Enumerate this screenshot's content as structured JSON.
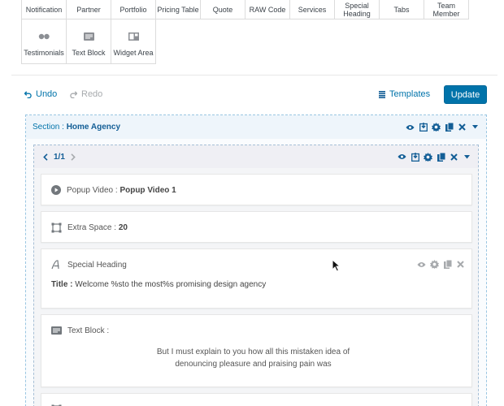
{
  "elements_row1": [
    "Notification",
    "Partner",
    "Portfolio",
    "Pricing Table",
    "Quote",
    "RAW Code",
    "Services",
    "Special Heading",
    "Tabs",
    "Team Member"
  ],
  "elements_row2": [
    {
      "label": "Testimonials",
      "icon": "testimonials-icon"
    },
    {
      "label": "Text Block",
      "icon": "text-block-icon"
    },
    {
      "label": "Widget Area",
      "icon": "widget-area-icon"
    }
  ],
  "toolbar": {
    "undo": "Undo",
    "redo": "Redo",
    "templates": "Templates",
    "update": "Update"
  },
  "section": {
    "prefix": "Section :",
    "name": "Home Agency"
  },
  "row": {
    "pager": "1/1"
  },
  "modules": {
    "popup_video": {
      "label": "Popup Video :",
      "value": "Popup Video 1"
    },
    "extra_space": {
      "label": "Extra Space :",
      "value": "20"
    },
    "special_heading": {
      "label": "Special Heading",
      "title_label": "Title :",
      "title_value": "Welcome %sto the most%s promising design agency"
    },
    "text_block": {
      "label": "Text Block :",
      "line1": "But I must explain to you how all this mistaken idea of",
      "line2": "denouncing pleasure and praising pain was"
    }
  },
  "colors": {
    "accent": "#0073aa",
    "icon": "#135e96",
    "muted": "#a7aaad"
  }
}
